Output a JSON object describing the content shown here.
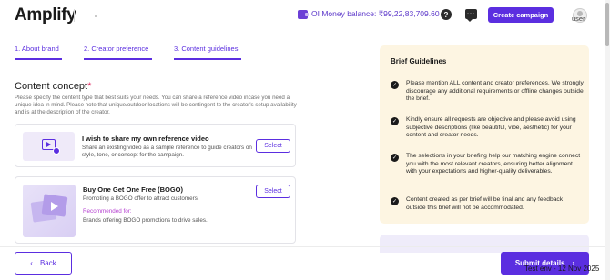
{
  "header": {
    "logo": "Amplify",
    "wallet_balance": "OI Money balance: ₹99,22,83,709.60",
    "wallet_chevron": "›",
    "help_glyph": "?",
    "create_campaign": "Create campaign",
    "avatar_label": "user"
  },
  "tabs": [
    {
      "label": "1. About brand"
    },
    {
      "label": "2. Creator preference"
    },
    {
      "label": "3. Content guidelines"
    }
  ],
  "content": {
    "title": "Content concept",
    "required_mark": "*",
    "description": "Please specify the content type that best suits your needs. You can share a reference video incase you need a unique idea in mind. Please note that unique/outdoor locations will be contingent to the creator's setup availability and is at the description of the creator.",
    "cards": [
      {
        "title": "I wish to share my own reference video",
        "description": "Share an existing video as a sample reference to guide creators on style, tone, or concept for the campaign.",
        "select_label": "Select"
      },
      {
        "title": "Buy One Get One Free (BOGO)",
        "description": "Promoting a BOGO offer to attract customers.",
        "recommended_label": "Recommended for:",
        "recommended_text": "Brands offering BOGO promotions to drive sales.",
        "select_label": "Select"
      }
    ]
  },
  "guidelines": {
    "title": "Brief Guidelines",
    "check_glyph": "✓",
    "items": [
      "Please mention ALL content and creator preferences. We strongly discourage any additional requirements or offline changes outside the brief.",
      "Kindly ensure all requests are objective and please avoid using subjective descriptions (like beautiful, vibe, aesthetic) for your content and creator needs.",
      "The selections in your briefing help our matching engine connect you with the most relevant creators, ensuring better alignment with your expectations and higher-quality deliverables.",
      "Content created as per brief will be final and any feedback outside this brief will not be accommodated."
    ]
  },
  "footer": {
    "back_label": "Back",
    "back_icon": "‹",
    "submit_label": "Submit details",
    "submit_icon": "›",
    "env_stamp": "Test env - 12 Nov 2025"
  },
  "colors": {
    "accent": "#5b2ee0",
    "guidelines_bg": "#fdf5e2",
    "recommended": "#b43fd0"
  }
}
